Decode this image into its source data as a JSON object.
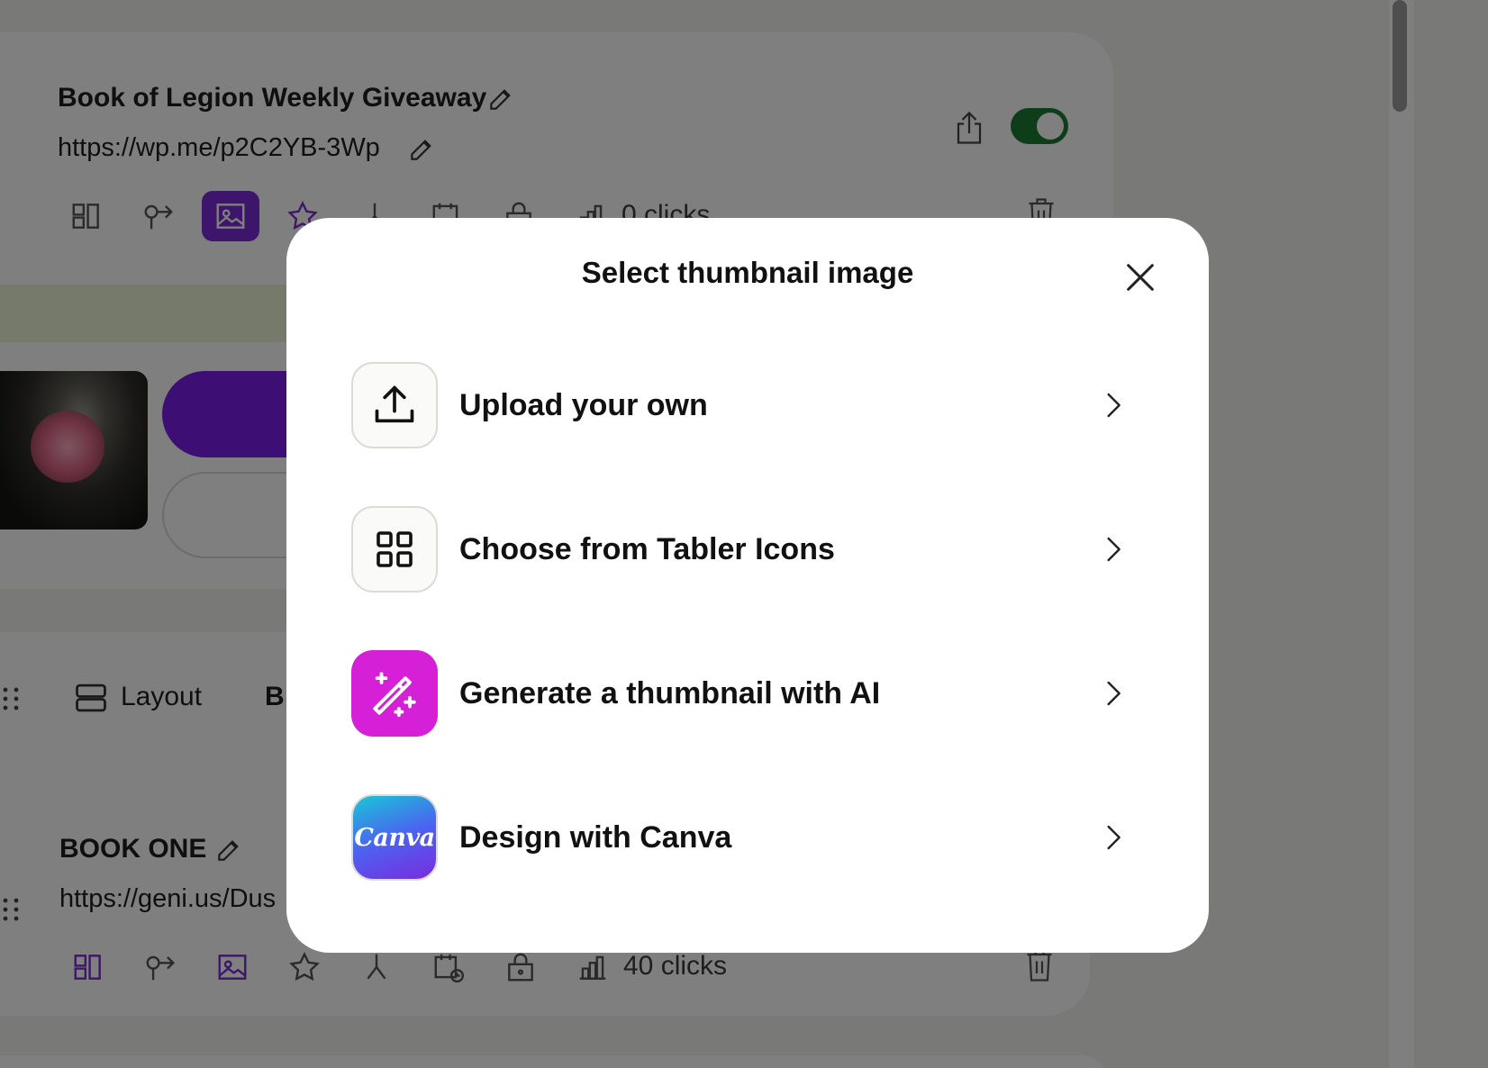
{
  "background": {
    "link1": {
      "title": "Book of Legion Weekly Giveaway",
      "url": "https://wp.me/p2C2YB-3Wp",
      "clicks": "0 clicks",
      "enabled": true
    },
    "section_tabs": {
      "layout_label": "Layout",
      "partial_label": "B"
    },
    "link2": {
      "title": "BOOK ONE",
      "url": "https://geni.us/Dus",
      "clicks": "40 clicks"
    },
    "colors": {
      "accent": "#7a2bd4",
      "toggle_on": "#1d7b32"
    }
  },
  "modal": {
    "title": "Select thumbnail image",
    "options": [
      {
        "label": "Upload your own",
        "icon": "upload-icon"
      },
      {
        "label": "Choose from Tabler Icons",
        "icon": "grid-icon"
      },
      {
        "label": "Generate a thumbnail with AI",
        "icon": "magic-wand-icon"
      },
      {
        "label": "Design with Canva",
        "icon": "canva-logo",
        "logo_text": "Canva"
      }
    ]
  }
}
